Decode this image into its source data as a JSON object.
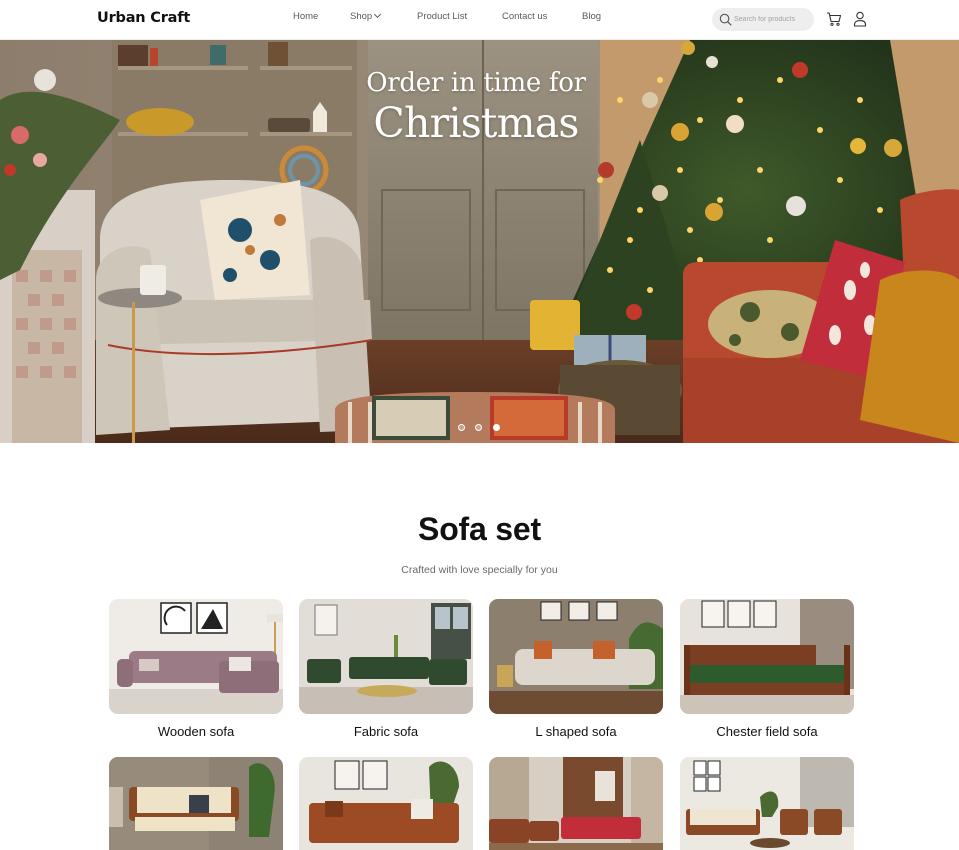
{
  "header": {
    "logo": "Urban Craft",
    "nav": [
      "Home",
      "Shop",
      "Product List",
      "Contact us",
      "Blog"
    ],
    "search": {
      "placeholder": "Search for products",
      "value": ""
    }
  },
  "hero": {
    "title_line1": "Order in time for",
    "title_line2": "Christmas",
    "slides_total": 3,
    "active_slide": 3
  },
  "section": {
    "title": "Sofa set",
    "subtitle": "Crafted with love specially for you"
  },
  "categories": [
    {
      "label": "Wooden sofa"
    },
    {
      "label": "Fabric sofa"
    },
    {
      "label": "L shaped sofa"
    },
    {
      "label": "Chester field sofa"
    },
    {
      "label": ""
    },
    {
      "label": ""
    },
    {
      "label": ""
    },
    {
      "label": ""
    }
  ],
  "colors": {
    "accent": "#111111",
    "header_bg": "#ffffff",
    "search_bg": "#eeeeee"
  },
  "icons": [
    "search-icon",
    "cart-icon",
    "user-icon",
    "chevron-down-icon"
  ]
}
